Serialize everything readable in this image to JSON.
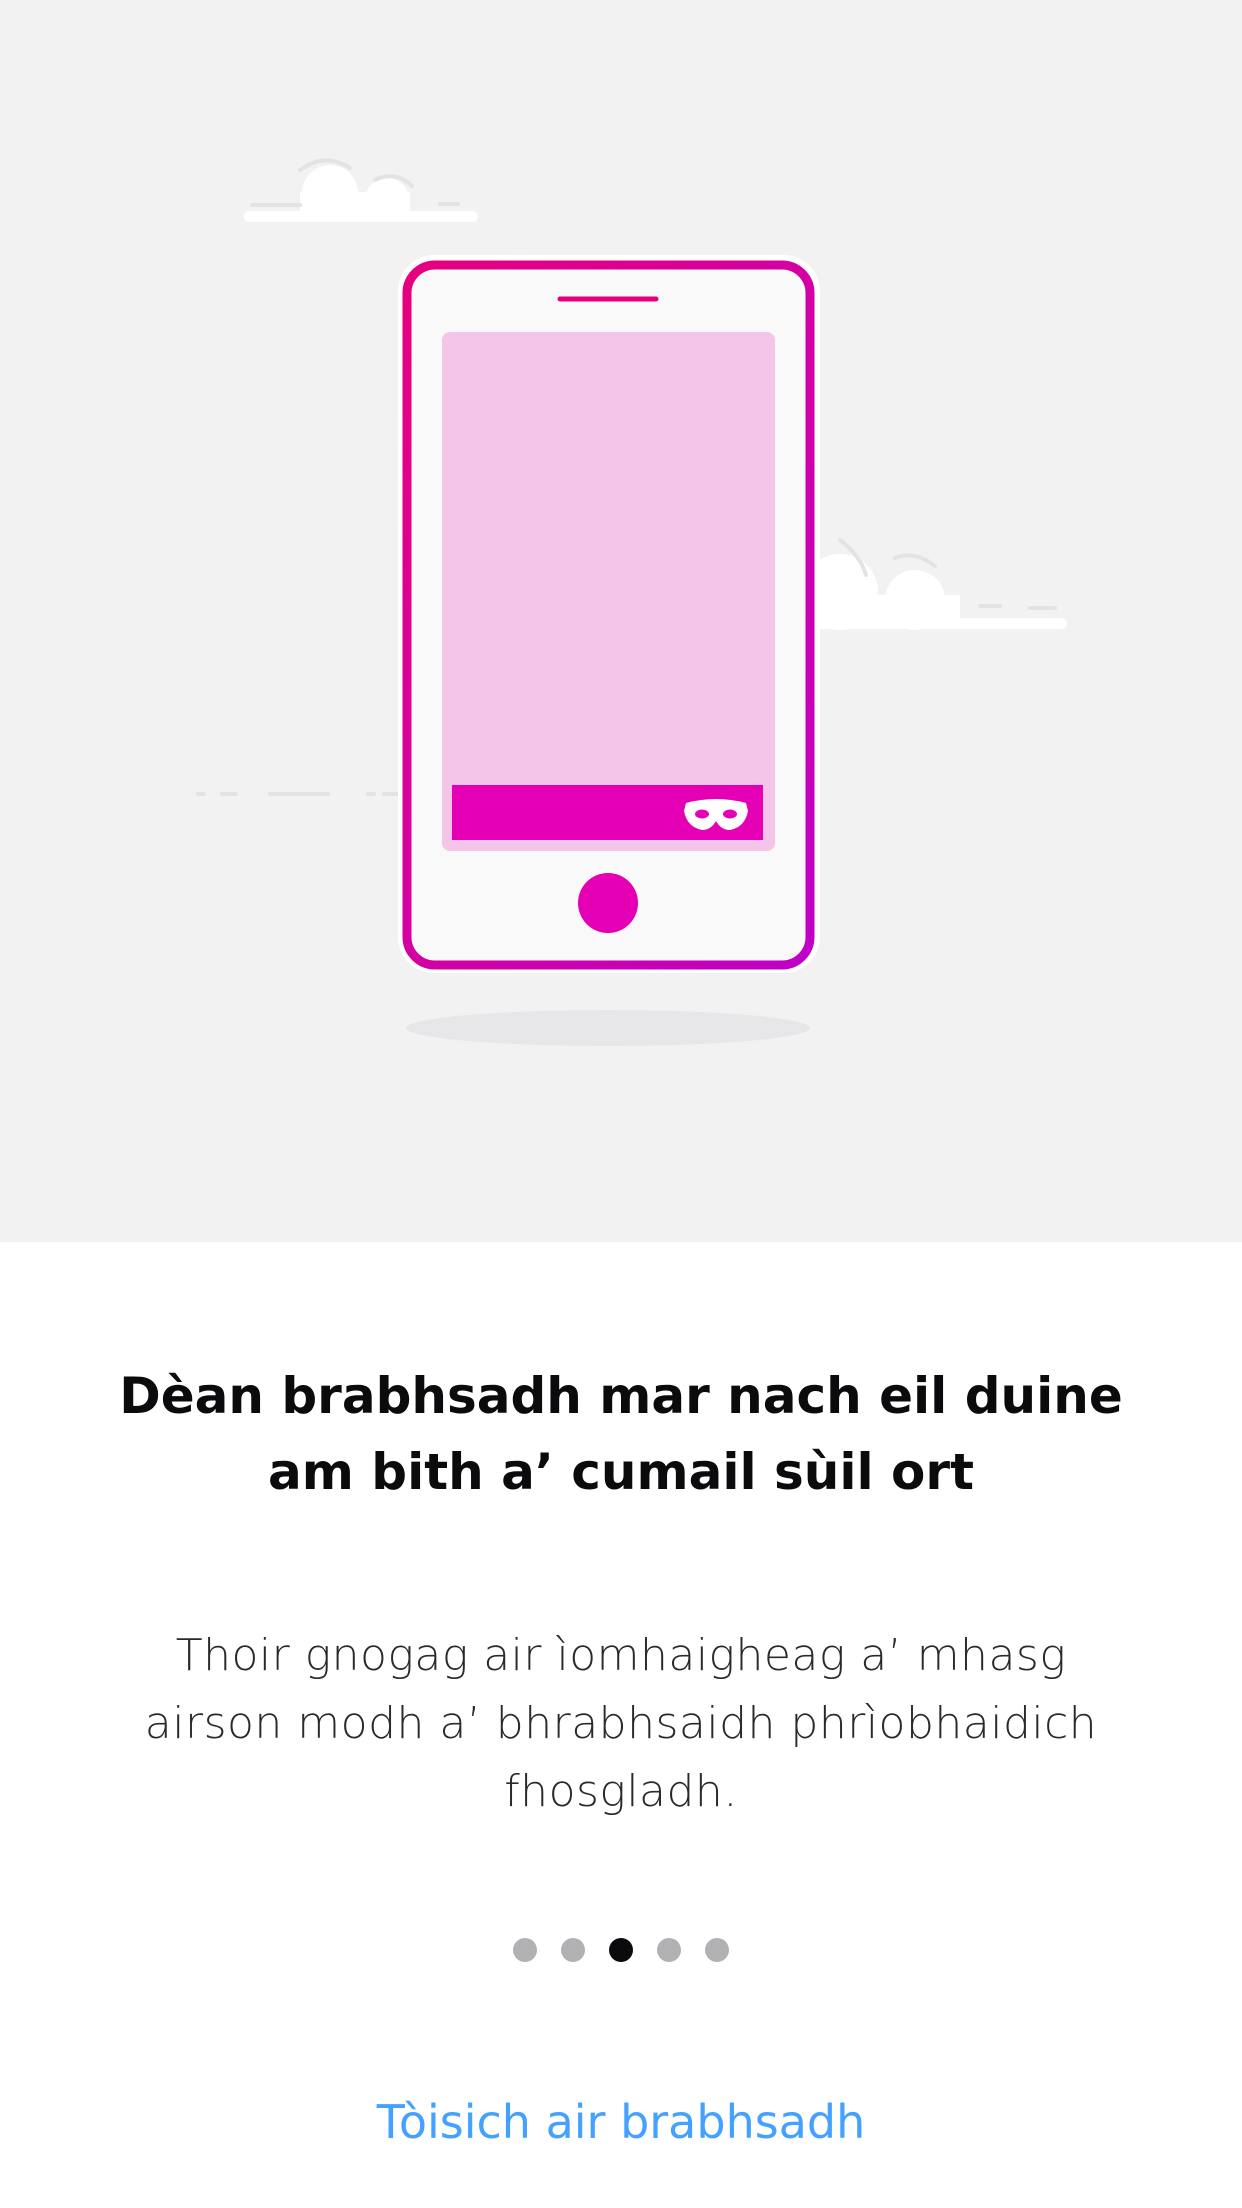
{
  "onboarding": {
    "title": "Dèan brabhsadh mar nach eil duine am bith a’ cumail sùil ort",
    "description": "Thoir gnogag air ìomhaigheag a’ mhasg airson modh a’ bhrabhsaidh phrìobhaidich fhosgladh.",
    "start_button": "Tòisich air brabhsadh",
    "pagination": {
      "total": 5,
      "current_index": 2
    }
  },
  "icons": {
    "illustration": "private-browsing-phone-illustration",
    "mask": "private-mask-icon",
    "clouds": "cloud-icon"
  },
  "colors": {
    "hero_background": "#f2f2f3",
    "phone_accent": "#e6007e",
    "screen_tint": "#f4c5e8",
    "toolbar": "#e500b5",
    "link": "#45a1ff",
    "dot_active": "#0b0b0d",
    "dot_inactive": "#b1b1b3"
  }
}
